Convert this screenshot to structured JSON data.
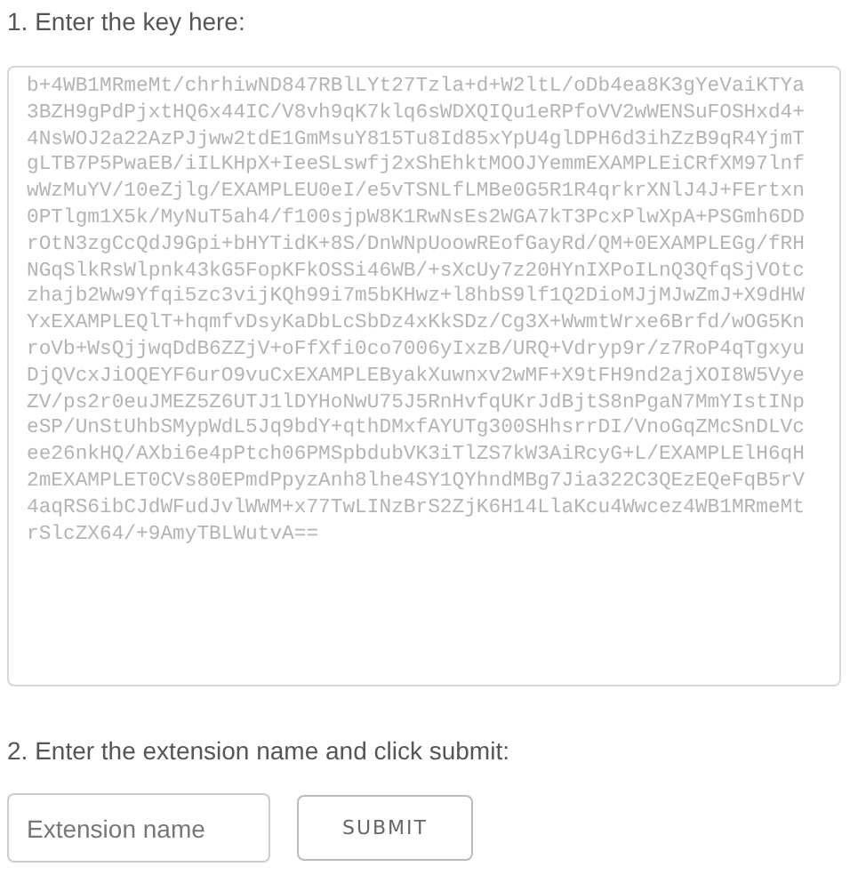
{
  "step_1": {
    "label": "1. Enter the key here:",
    "key": "b+4WB1MRmeMt/chrhiwND847RBlLYt27Tzla+d+W2ltL/oDb4ea8K3gYeVaiKTYa3BZH9gPdPjxtHQ6x44IC/V8vh9qK7klq6sWDXQIQu1eRPfoVV2wWENSuFOSHxd4+4NsWOJ2a22AzPJjww2tdE1GmMsuY815Tu8Id85xYpU4glDPH6d3ihZzB9qR4YjmTgLTB7P5PwaEB/iILKHpX+IeeSLswfj2xShEhktMOOJYemmEXAMPLEiCRfXM97lnfwWzMuYV/10eZjlg/EXAMPLEU0eI/e5vTSNLfLMBe0G5R1R4qrkrXNlJ4J+FErtxn0PTlgm1X5k/MyNuT5ah4/f100sjpW8K1RwNsEs2WGA7kT3PcxPlwXpA+PSGmh6DDrOtN3zgCcQdJ9Gpi+bHYTidK+8S/DnWNpUoowREofGayRd/QM+0EXAMPLEGg/fRHNGqSlkRsWlpnk43kG5FopKFkOSSi46WB/+sXcUy7z20HYnIXPoILnQ3QfqSjVOtczhajb2Ww9Yfqi5zc3vijKQh99i7m5bKHwz+l8hbS9lf1Q2DioMJjMJwZmJ+X9dHWYxEXAMPLEQlT+hqmfvDsyKaDbLcSbDz4xKkSDz/Cg3X+WwmtWrxe6Brfd/wOG5KnroVb+WsQjjwqDdB6ZZjV+oFfXfi0co7006yIxzB/URQ+Vdryp9r/z7RoP4qTgxyuDjQVcxJiOQEYF6urO9vuCxEXAMPLEByakXuwnxv2wMF+X9tFH9nd2ajXOI8W5VyeZV/ps2r0euJMEZ5Z6UTJ1lDYHoNwU75J5RnHvfqUKrJdBjtS8nPgaN7MmYIstINpeSP/UnStUhbSMypWdL5Jq9bdY+qthDMxfAYUTg300SHhsrrDI/VnoGqZMcSnDLVcee26nkHQ/AXbi6e4pPtch06PMSpbdubVK3iTlZS7kW3AiRcyG+L/EXAMPLElH6qH2mEXAMPLET0CVs80EPmdPpyzAnh8lhe4SY1QYhndMBg7Jia322C3QEzEQeFqB5rV4aqRS6ibCJdWFudJvlWWM+x77TwLINzBrS2ZjK6H14LlaKcu4Wwcez4WB1MRmeMtrSlcZX64/+9AmyTBLWutvA=="
  },
  "step_2": {
    "label": "2. Enter the extension name and click submit:",
    "field": {
      "placeholder": "Extension name"
    },
    "button": "SUBMIT"
  }
}
